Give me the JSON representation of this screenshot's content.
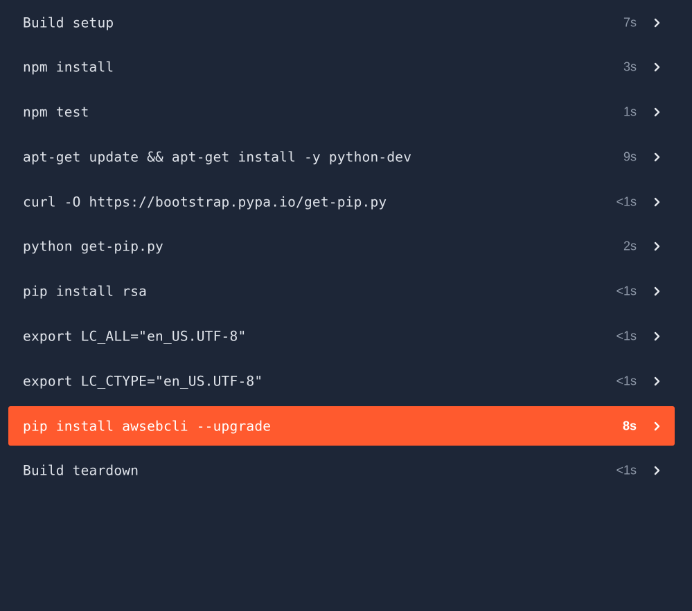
{
  "colors": {
    "background": "#1d2637",
    "failed_step": "#ff5a2e",
    "text": "#dfe3ea",
    "duration_text": "#8e98a8"
  },
  "steps": [
    {
      "label": "Build setup",
      "duration": "7s",
      "status": "normal",
      "icon": "chevron-right-icon"
    },
    {
      "label": "npm install",
      "duration": "3s",
      "status": "normal",
      "icon": "chevron-right-icon"
    },
    {
      "label": "npm test",
      "duration": "1s",
      "status": "normal",
      "icon": "chevron-right-icon"
    },
    {
      "label": "apt-get update && apt-get install -y python-dev",
      "duration": "9s",
      "status": "normal",
      "icon": "chevron-right-icon"
    },
    {
      "label": "curl -O https://bootstrap.pypa.io/get-pip.py",
      "duration": "<1s",
      "status": "normal",
      "icon": "chevron-right-icon"
    },
    {
      "label": "python get-pip.py",
      "duration": "2s",
      "status": "normal",
      "icon": "chevron-right-icon"
    },
    {
      "label": "pip install rsa",
      "duration": "<1s",
      "status": "normal",
      "icon": "chevron-right-icon"
    },
    {
      "label": "export LC_ALL=\"en_US.UTF-8\"",
      "duration": "<1s",
      "status": "normal",
      "icon": "chevron-right-icon"
    },
    {
      "label": "export LC_CTYPE=\"en_US.UTF-8\"",
      "duration": "<1s",
      "status": "normal",
      "icon": "chevron-right-icon"
    },
    {
      "label": "pip install awsebcli --upgrade",
      "duration": "8s",
      "status": "failed",
      "icon": "chevron-right-icon"
    },
    {
      "label": "Build teardown",
      "duration": "<1s",
      "status": "normal",
      "icon": "chevron-right-icon"
    }
  ]
}
